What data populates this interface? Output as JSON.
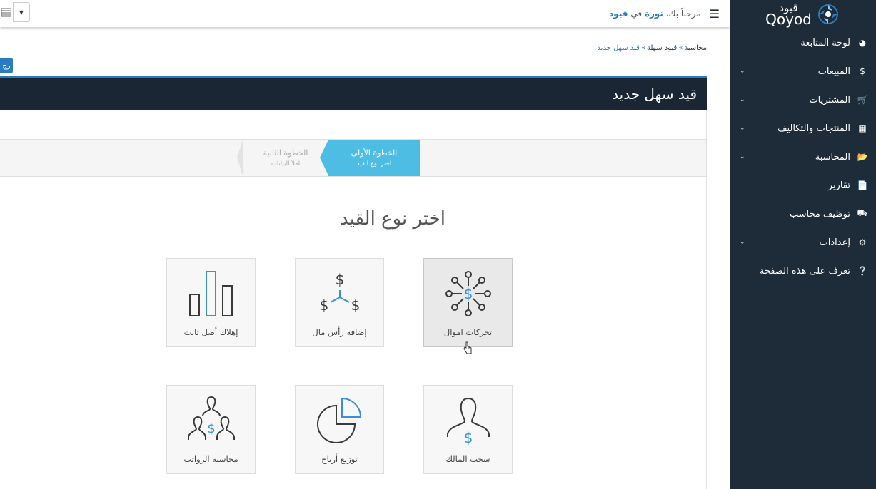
{
  "app": {
    "logo_text": "Qoyod",
    "logo_arabic": "قيود"
  },
  "topbar": {
    "welcome_prefix": "مرحباً بك،",
    "user_name": "نورة",
    "welcome_in": "في",
    "company": "قيود"
  },
  "sidebar": {
    "items": [
      {
        "label": "لوحة المتابعة",
        "icon": "dashboard-icon",
        "has_submenu": false
      },
      {
        "label": "المبيعات",
        "icon": "dollar-icon",
        "has_submenu": true
      },
      {
        "label": "المشتريات",
        "icon": "cart-icon",
        "has_submenu": true
      },
      {
        "label": "المنتجات والتكاليف",
        "icon": "grid-icon",
        "has_submenu": true
      },
      {
        "label": "المحاسبة",
        "icon": "folder-icon",
        "has_submenu": true
      },
      {
        "label": "تقارير",
        "icon": "document-icon",
        "has_submenu": false
      },
      {
        "label": "توظيف محاسب",
        "icon": "truck-icon",
        "has_submenu": false
      },
      {
        "label": "إعدادات",
        "icon": "gear-icon",
        "has_submenu": true
      },
      {
        "label": "تعرف على هذه الصفحة",
        "icon": "question-circle-icon",
        "has_submenu": false
      }
    ]
  },
  "breadcrumb": {
    "items": [
      "محاسبة",
      "قيود سهلة",
      "قيد سهل جديد"
    ],
    "separator": "»"
  },
  "top_action": {
    "label": "رج"
  },
  "panel": {
    "title": "قيد سهل جديد"
  },
  "wizard": {
    "steps": [
      {
        "title": "الخطوة الأولى",
        "subtitle": "اختر نوع القيد",
        "active": true
      },
      {
        "title": "الخطوة الثانية",
        "subtitle": "املأ البيانات",
        "active": false
      }
    ]
  },
  "main": {
    "heading": "اختر نوع القيد",
    "options": [
      {
        "label": "تحركات اموال",
        "icon": "money-flow-icon",
        "selected": true
      },
      {
        "label": "إضافة رأس مال",
        "icon": "capital-icon",
        "selected": false
      },
      {
        "label": "إهلاك أصل ثابت",
        "icon": "bar-chart-icon",
        "selected": false
      },
      {
        "label": "سحب المالك",
        "icon": "owner-withdraw-icon",
        "selected": false
      },
      {
        "label": "توزيع أرباح",
        "icon": "pie-chart-icon",
        "selected": false
      },
      {
        "label": "محاسبة الرواتب",
        "icon": "payroll-icon",
        "selected": false
      }
    ]
  },
  "colors": {
    "sidebar_bg": "#1e2b38",
    "panel_header_bg": "#1a2634",
    "accent_blue": "#2a7bc0",
    "step_active": "#4dbde4",
    "icon_dark": "#3a3a3a",
    "icon_blue": "#3a8fd8"
  }
}
